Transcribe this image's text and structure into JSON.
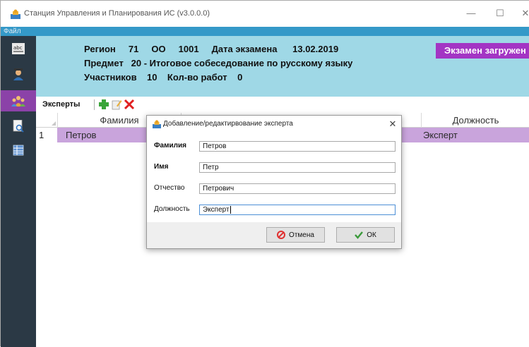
{
  "app": {
    "title": "Станция Управления и Планирования ИС (v3.0.0.0)",
    "minimize": "—",
    "maximize": "☐",
    "close": "✕"
  },
  "menu": {
    "file": "Файл"
  },
  "sidebar": {
    "items": [
      {
        "icon": "abc-icon"
      },
      {
        "icon": "user-award-icon"
      },
      {
        "icon": "users-icon",
        "active": true
      },
      {
        "icon": "document-search-icon"
      },
      {
        "icon": "table-icon"
      }
    ]
  },
  "info": {
    "line1": "Регион     71     ОО     1001     Дата экзамена      13.02.2019",
    "line2": "Предмет   20 - Итоговое собеседование по русскому языку",
    "line3": "Участников    10    Кол-во работ    0",
    "status": "Экзамен загружен"
  },
  "toolbar": {
    "label": "Эксперты"
  },
  "grid": {
    "columns": {
      "surname": "Фамилия",
      "position": "Должность"
    },
    "rows": [
      {
        "num": "1",
        "surname": "Петров",
        "position": "Эксперт"
      }
    ]
  },
  "dialog": {
    "title": "Добавление/редактирвование эксперта",
    "close": "✕",
    "fields": {
      "surname": {
        "label": "Фамилия",
        "value": "Петров"
      },
      "name": {
        "label": "Имя",
        "value": "Петр"
      },
      "patronymic": {
        "label": "Отчество",
        "value": "Петрович"
      },
      "position": {
        "label": "Должность",
        "value": "Эксперт"
      }
    },
    "cancel": "Отмена",
    "ok": "ОК"
  },
  "colors": {
    "menubar": "#3499c8",
    "sidebar": "#2b3945",
    "sidebar_active": "#8b42a8",
    "info_panel": "#9fd8e6",
    "status_badge": "#a335c4",
    "row_selected": "#c9a4dc"
  }
}
